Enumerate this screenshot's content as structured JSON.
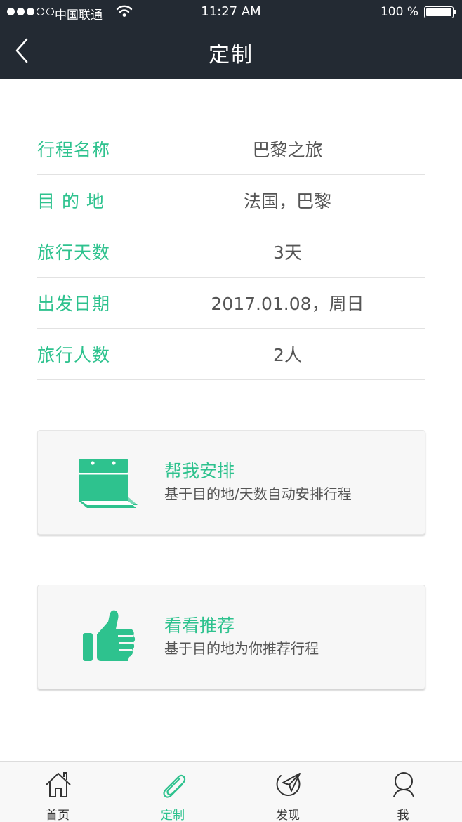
{
  "status_bar": {
    "carrier": "中国联通",
    "time": "11:27 AM",
    "battery_percent": "100 %",
    "signal_bars_filled": 3,
    "signal_bars_total": 5
  },
  "nav": {
    "title": "定制"
  },
  "form": {
    "rows": [
      {
        "label": "行程名称",
        "value": "巴黎之旅"
      },
      {
        "label": "目 的 地",
        "value": "法国，巴黎"
      },
      {
        "label": "旅行天数",
        "value": "3天"
      },
      {
        "label": "出发日期",
        "value": "2017.01.08，周日"
      },
      {
        "label": "旅行人数",
        "value": "2人"
      }
    ]
  },
  "cards": [
    {
      "title": "帮我安排",
      "subtitle": "基于目的地/天数自动安排行程",
      "icon": "calendar-icon"
    },
    {
      "title": "看看推荐",
      "subtitle": "基于目的地为你推荐行程",
      "icon": "thumbs-up-icon"
    }
  ],
  "tabbar": {
    "items": [
      {
        "label": "首页",
        "icon": "home-icon"
      },
      {
        "label": "定制",
        "icon": "paperclip-icon",
        "active": true
      },
      {
        "label": "发现",
        "icon": "compass-icon"
      },
      {
        "label": "我",
        "icon": "user-icon"
      }
    ]
  },
  "colors": {
    "accent": "#2ec28e",
    "header_bg": "#232a33",
    "text": "#555555"
  }
}
